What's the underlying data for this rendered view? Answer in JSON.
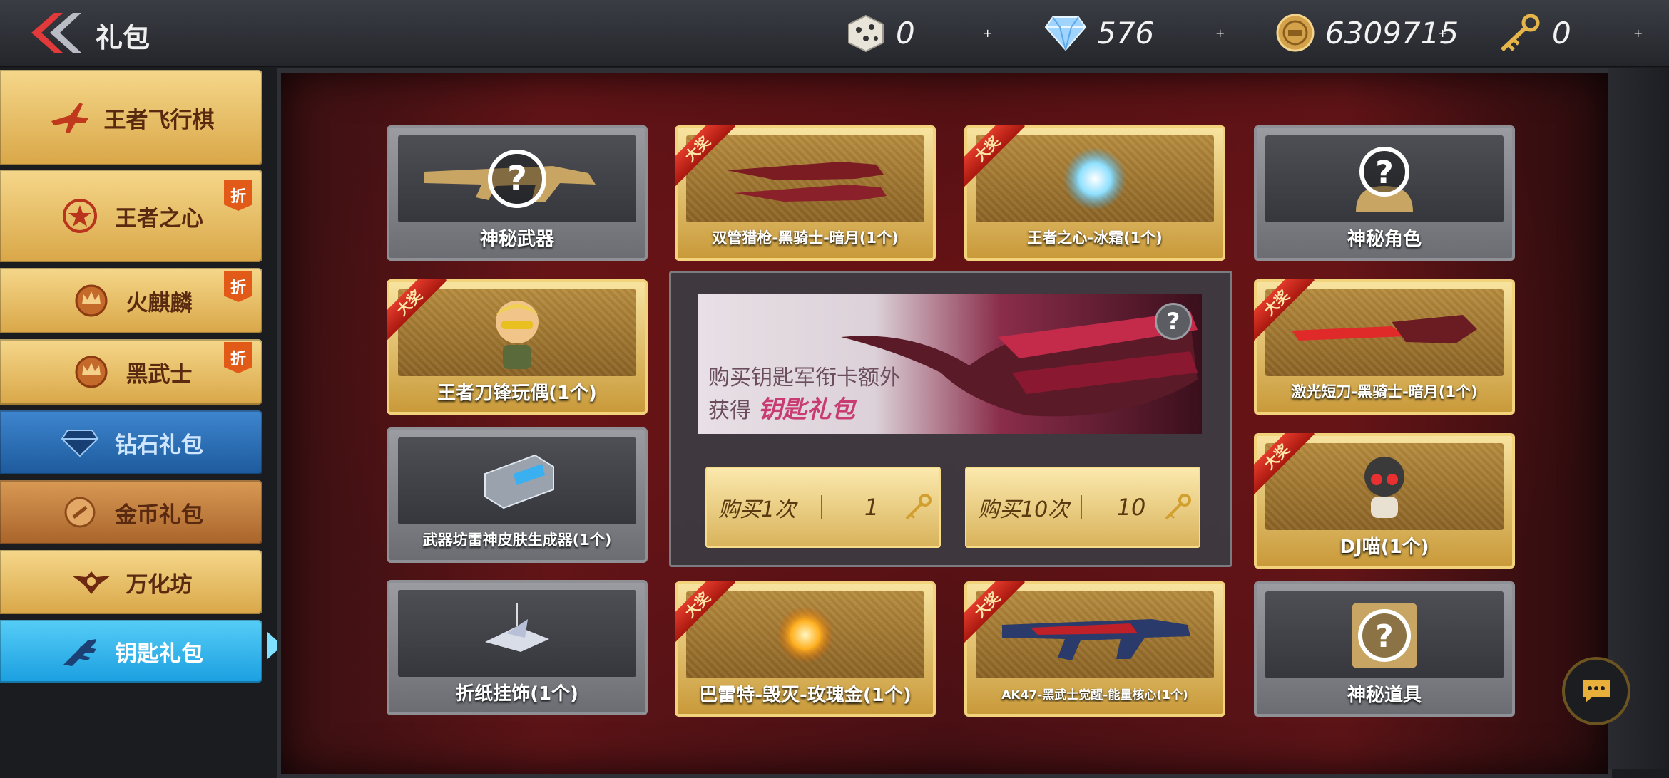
{
  "header": {
    "title": "礼包",
    "currencies": [
      {
        "icon": "dice-icon",
        "value": "0"
      },
      {
        "icon": "diamond-icon",
        "value": "576"
      },
      {
        "icon": "gold-coin-icon",
        "value": "6309715"
      },
      {
        "icon": "key-icon",
        "value": "0"
      }
    ]
  },
  "sidebar": {
    "items": [
      {
        "label": "王者飞行棋",
        "icon": "jet-icon",
        "badge": ""
      },
      {
        "label": "王者之心",
        "icon": "star-emblem-icon",
        "badge": "折"
      },
      {
        "label": "火麒麟",
        "icon": "crown-emblem-icon",
        "badge": "折"
      },
      {
        "label": "黑武士",
        "icon": "crown-emblem-icon",
        "badge": "折"
      },
      {
        "label": "钻石礼包",
        "icon": "diamond-icon",
        "badge": ""
      },
      {
        "label": "金币礼包",
        "icon": "coin-icon",
        "badge": ""
      },
      {
        "label": "万化坊",
        "icon": "winged-emblem-icon",
        "badge": ""
      },
      {
        "label": "钥匙礼包",
        "icon": "key-wing-icon",
        "badge": ""
      }
    ],
    "active_index": 7
  },
  "rewards": {
    "ribbon_text": "大奖",
    "cards": [
      {
        "name": "神秘武器",
        "style": "gray",
        "ribbon": false,
        "icon": "mystery-weapon-icon"
      },
      {
        "name": "双管猎枪-黑骑士-暗月(1个)",
        "style": "gold",
        "ribbon": true,
        "icon": "shotgun-icon"
      },
      {
        "name": "王者之心-冰霜(1个)",
        "style": "gold",
        "ribbon": true,
        "icon": "ice-orb-icon"
      },
      {
        "name": "神秘角色",
        "style": "gray",
        "ribbon": false,
        "icon": "mystery-character-icon"
      },
      {
        "name": "王者刀锋玩偶(1个)",
        "style": "gold",
        "ribbon": true,
        "icon": "doll-icon"
      },
      {
        "name": "激光短刀-黑骑士-暗月(1个)",
        "style": "gold",
        "ribbon": true,
        "icon": "laser-knife-icon"
      },
      {
        "name": "武器坊雷神皮肤生成器(1个)",
        "style": "gray",
        "ribbon": false,
        "icon": "skin-generator-icon"
      },
      {
        "name": "DJ喵(1个)",
        "style": "gold",
        "ribbon": true,
        "icon": "dj-cat-icon"
      },
      {
        "name": "折纸挂饰(1个)",
        "style": "gray",
        "ribbon": false,
        "icon": "paper-crane-icon"
      },
      {
        "name": "巴雷特-毁灭-玫瑰金(1个)",
        "style": "gold",
        "ribbon": true,
        "icon": "fire-orb-icon"
      },
      {
        "name": "AK47-黑武士觉醒-能量核心(1个)",
        "style": "gold",
        "ribbon": true,
        "icon": "ak47-icon"
      },
      {
        "name": "神秘道具",
        "style": "gray",
        "ribbon": false,
        "icon": "mystery-item-icon"
      }
    ]
  },
  "center": {
    "banner_line1": "购买钥匙军衔卡额外",
    "banner_line2_prefix": "获得",
    "banner_line2_highlight": "钥匙礼包",
    "help_label": "?",
    "buy_once": {
      "label": "购买1次",
      "count": "1"
    },
    "buy_ten": {
      "label": "购买10次",
      "count": "10"
    }
  },
  "colors": {
    "accent_active": "#1b9fe0",
    "ribbon": "#c8251a",
    "gold": "#d9b35c"
  }
}
